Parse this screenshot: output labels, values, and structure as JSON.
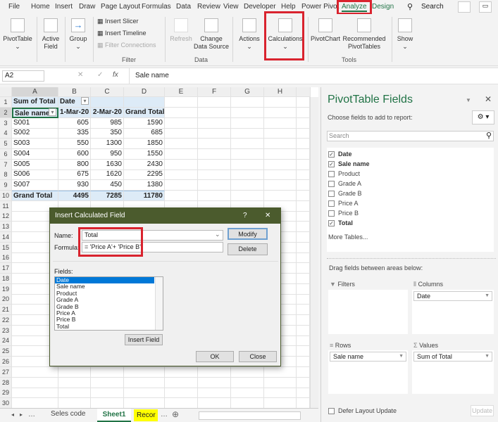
{
  "menu_tabs": [
    "File",
    "Home",
    "Insert",
    "Draw",
    "Page Layout",
    "Formulas",
    "Data",
    "Review",
    "View",
    "Developer",
    "Help",
    "Power Pivot",
    "Analyze",
    "Design"
  ],
  "active_tab": "Analyze",
  "search_label": "Search",
  "ribbon": {
    "pivottable": "PivotTable",
    "active_field": "Active Field",
    "group": "Group",
    "insert_slicer": "Insert Slicer",
    "insert_timeline": "Insert Timeline",
    "filter_connections": "Filter Connections",
    "filter_group": "Filter",
    "refresh": "Refresh",
    "change_data_source": "Change Data Source",
    "data_group": "Data",
    "actions": "Actions",
    "calculations": "Calculations",
    "pivotchart": "PivotChart",
    "recommended": "Recommended PivotTables",
    "tools_group": "Tools",
    "show": "Show"
  },
  "formula_bar": {
    "name_box": "A2",
    "fx": "fx",
    "value": "Sale name"
  },
  "columns": [
    "A",
    "B",
    "C",
    "D",
    "E",
    "F",
    "G",
    "H"
  ],
  "pivot": {
    "corner": "Sum of Total",
    "col_label": "Date",
    "row_label": "Sale name",
    "headers": [
      "1-Mar-20",
      "2-Mar-20",
      "Grand Total"
    ],
    "rows": [
      [
        "S001",
        "605",
        "985",
        "1590"
      ],
      [
        "S002",
        "335",
        "350",
        "685"
      ],
      [
        "S003",
        "550",
        "1300",
        "1850"
      ],
      [
        "S004",
        "600",
        "950",
        "1550"
      ],
      [
        "S005",
        "800",
        "1630",
        "2430"
      ],
      [
        "S006",
        "675",
        "1620",
        "2295"
      ],
      [
        "S007",
        "930",
        "450",
        "1380"
      ]
    ],
    "total": [
      "Grand Total",
      "4495",
      "7285",
      "11780"
    ]
  },
  "dialog": {
    "title": "Insert Calculated Field",
    "help": "?",
    "close_x": "✕",
    "name_label": "Name:",
    "name_value": "Total",
    "formula_label": "Formula:",
    "formula_value": "= 'Price A'+ 'Price B'",
    "modify": "Modify",
    "delete": "Delete",
    "fields_label": "Fields:",
    "fields": [
      "Date",
      "Sale name",
      "Product",
      "Grade A",
      "Grade B",
      "Price A",
      "Price B",
      "Total"
    ],
    "insert_field": "Insert Field",
    "ok": "OK",
    "close": "Close"
  },
  "pane": {
    "title": "PivotTable Fields",
    "choose": "Choose fields to add to report:",
    "search_placeholder": "Search",
    "fields": [
      {
        "label": "Date",
        "checked": true
      },
      {
        "label": "Sale name",
        "checked": true
      },
      {
        "label": "Product",
        "checked": false
      },
      {
        "label": "Grade A",
        "checked": false
      },
      {
        "label": "Grade B",
        "checked": false
      },
      {
        "label": "Price A",
        "checked": false
      },
      {
        "label": "Price B",
        "checked": false
      },
      {
        "label": "Total",
        "checked": true
      }
    ],
    "more_tables": "More Tables...",
    "drag": "Drag fields between areas below:",
    "filters": "Filters",
    "columns": "Columns",
    "rows": "Rows",
    "values": "Values",
    "columns_item": "Date",
    "rows_item": "Sale name",
    "values_item": "Sum of Total",
    "defer": "Defer Layout Update",
    "update": "Update"
  },
  "sheet_tabs": [
    "Seles code",
    "Sheet1",
    "Recor"
  ],
  "active_sheet": "Sheet1",
  "colors": {
    "accent": "#217346",
    "highlight": "#d9232e",
    "dialog_title": "#4b5b2d",
    "pivot_header": "#ddebf7"
  }
}
